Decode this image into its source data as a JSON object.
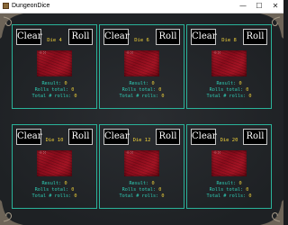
{
  "window": {
    "title": "DungeonDice",
    "minimize": "—",
    "maximize": "☐",
    "close": "✕"
  },
  "colors": {
    "accent": "#2ab39a",
    "label": "#f0d23a",
    "stat": "#2fd0b8",
    "die": "#a51424"
  },
  "panels": [
    {
      "clear": "Clear",
      "roll": "Roll",
      "die": "Die 4",
      "result_label": "Result:",
      "result": "0",
      "rolls_total_label": "Rolls total:",
      "rolls_total": "0",
      "num_rolls_label": "Total # rolls:",
      "num_rolls": "0"
    },
    {
      "clear": "Clear",
      "roll": "Roll",
      "die": "Die 6",
      "result_label": "Result:",
      "result": "0",
      "rolls_total_label": "Rolls total:",
      "rolls_total": "0",
      "num_rolls_label": "Total # rolls:",
      "num_rolls": "0"
    },
    {
      "clear": "Clear",
      "roll": "Roll",
      "die": "Die 8",
      "result_label": "Result:",
      "result": "0",
      "rolls_total_label": "Rolls total:",
      "rolls_total": "0",
      "num_rolls_label": "Total # rolls:",
      "num_rolls": "0"
    },
    {
      "clear": "Clear",
      "roll": "Roll",
      "die": "Die 10",
      "result_label": "Result:",
      "result": "0",
      "rolls_total_label": "Rolls total:",
      "rolls_total": "0",
      "num_rolls_label": "Total # rolls:",
      "num_rolls": "0"
    },
    {
      "clear": "Clear",
      "roll": "Roll",
      "die": "Die 12",
      "result_label": "Result:",
      "result": "0",
      "rolls_total_label": "Rolls total:",
      "rolls_total": "0",
      "num_rolls_label": "Total # rolls:",
      "num_rolls": "0"
    },
    {
      "clear": "Clear",
      "roll": "Roll",
      "die": "Die 20",
      "result_label": "Result:",
      "result": "0",
      "rolls_total_label": "Rolls total:",
      "rolls_total": "0",
      "num_rolls_label": "Total # rolls:",
      "num_rolls": "0"
    }
  ]
}
